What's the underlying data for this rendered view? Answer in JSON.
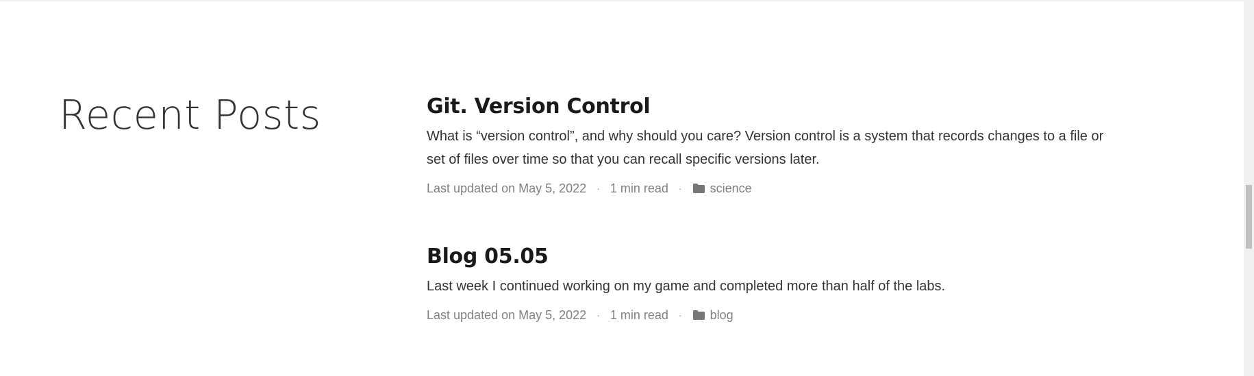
{
  "section": {
    "heading": "Recent Posts"
  },
  "posts": [
    {
      "title": "Git. Version Control",
      "excerpt": "What is “version control”, and why should you care? Version control is a system that records changes to a file or set of files over time so that you can recall specific versions later.",
      "updated": "Last updated on May 5, 2022",
      "read_time": "1 min read",
      "category": "science",
      "separator": "·",
      "category_icon": "folder-icon"
    },
    {
      "title": "Blog 05.05",
      "excerpt": "Last week I continued working on my game and completed more than half of the labs.",
      "updated": "Last updated on May 5, 2022",
      "read_time": "1 min read",
      "category": "blog",
      "separator": "·",
      "category_icon": "folder-icon"
    }
  ],
  "colors": {
    "heading": "#333333",
    "title": "#1a1a1a",
    "meta": "#808080",
    "icon": "#777777"
  }
}
